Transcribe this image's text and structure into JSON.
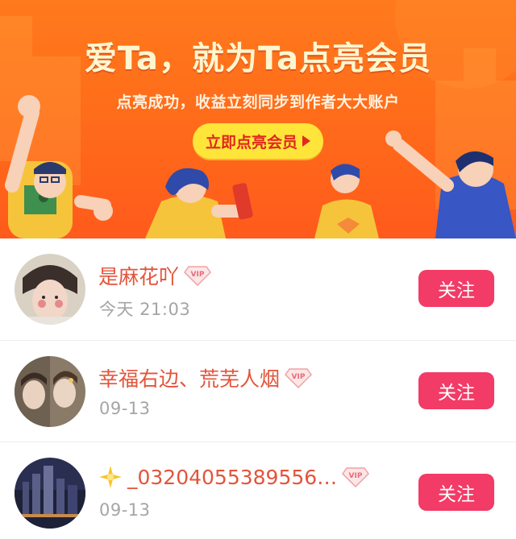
{
  "banner": {
    "title": "爱Ta，就为Ta点亮会员",
    "subtitle": "点亮成功，收益立刻同步到作者大大账户",
    "cta_label": "立即点亮会员"
  },
  "colors": {
    "banner_orange": "#ff6a1a",
    "cta_yellow": "#ffe53a",
    "name_red": "#e3543b",
    "follow_pink": "#f23b66",
    "time_gray": "#a5a5a5"
  },
  "followers": [
    {
      "name": "是麻花吖",
      "vip": true,
      "time": "今天  21:03",
      "follow_label": "关注"
    },
    {
      "name": "幸福右边、荒芜人烟",
      "vip": true,
      "time": "09-13",
      "follow_label": "关注"
    },
    {
      "name_prefix_icon": "sparkle-star-icon",
      "name": "_03204055389556…",
      "vip": true,
      "time": "09-13",
      "follow_label": "关注"
    }
  ]
}
